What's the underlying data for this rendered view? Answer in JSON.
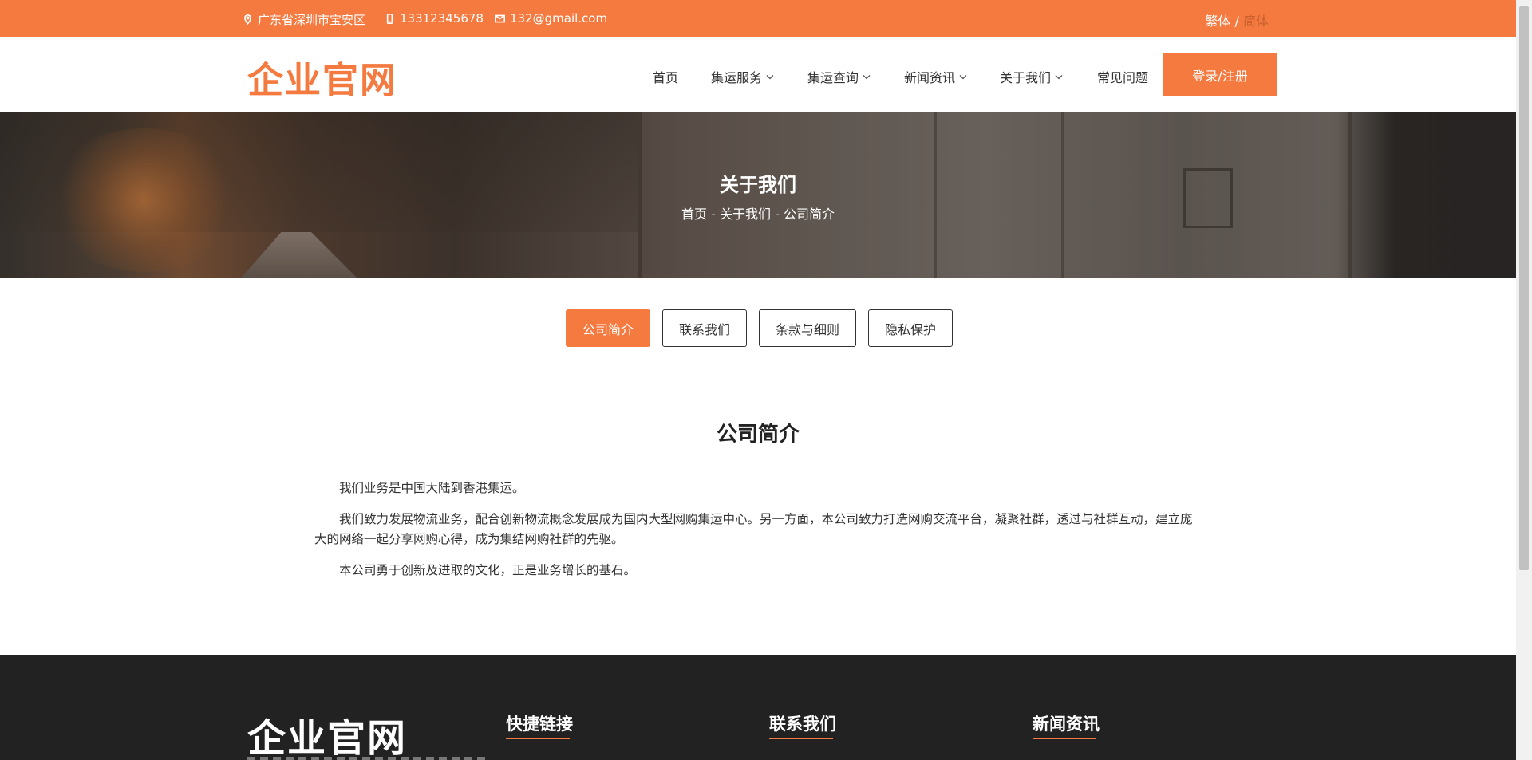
{
  "topbar": {
    "address": "广东省深圳市宝安区",
    "phone": "13312345678",
    "email": "132@gmail.com",
    "lang_traditional": "繁体 /",
    "lang_simplified": "简体"
  },
  "header": {
    "logo": "企业官网",
    "nav": [
      {
        "label": "首页"
      },
      {
        "label": "集运服务"
      },
      {
        "label": "集运查询"
      },
      {
        "label": "新闻资讯"
      },
      {
        "label": "关于我们"
      },
      {
        "label": "常见问题"
      }
    ],
    "login": "登录/注册"
  },
  "banner": {
    "title": "关于我们",
    "breadcrumb": "首页  - 关于我们  - 公司简介"
  },
  "tabs": [
    {
      "label": "公司简介",
      "active": true
    },
    {
      "label": "联系我们",
      "active": false
    },
    {
      "label": "条款与细则",
      "active": false
    },
    {
      "label": "隐私保护",
      "active": false
    }
  ],
  "content": {
    "title": "公司简介",
    "paragraphs": [
      "我们业务是中国大陆到香港集运。",
      "我们致力发展物流业务，配合创新物流概念发展成为国内大型网购集运中心。另一方面，本公司致力打造网购交流平台，凝聚社群，透过与社群互动，建立庞大的网络一起分享网购心得，成为集结网购社群的先驱。",
      "本公司勇于创新及进取的文化，正是业务增长的基石。"
    ]
  },
  "footer": {
    "logo": "企业官网",
    "headings": [
      "快捷链接",
      "联系我们",
      "新闻资讯"
    ]
  },
  "colors": {
    "accent": "#f47a40",
    "footer_bg": "#222222"
  }
}
